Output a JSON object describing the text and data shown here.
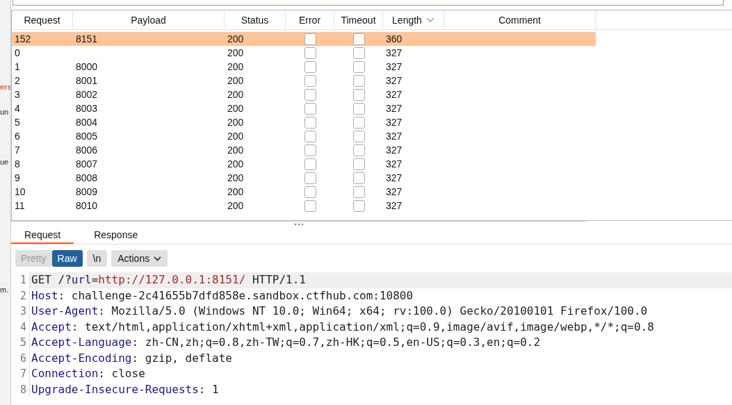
{
  "side_fragments": [
    {
      "text": "ers",
      "kind": "accent"
    },
    {
      "text": "un",
      "kind": "plain"
    },
    {
      "text": "ue",
      "kind": "plain"
    },
    {
      "text": "m.",
      "kind": "plain"
    }
  ],
  "table": {
    "columns": [
      {
        "label": "Request",
        "sorted": false
      },
      {
        "label": "Payload",
        "sorted": false
      },
      {
        "label": "Status",
        "sorted": false
      },
      {
        "label": "Error",
        "sorted": false
      },
      {
        "label": "Timeout",
        "sorted": false
      },
      {
        "label": "Length",
        "sorted": true
      },
      {
        "label": "Comment",
        "sorted": false
      }
    ],
    "rows": [
      {
        "request": "152",
        "payload": "8151",
        "status": "200",
        "error": false,
        "timeout": false,
        "length": "360",
        "selected": true
      },
      {
        "request": "0",
        "status": "200",
        "error": false,
        "timeout": false,
        "length": "327",
        "selected": false
      },
      {
        "request": "1",
        "payload": "8000",
        "status": "200",
        "error": false,
        "timeout": false,
        "length": "327",
        "selected": false
      },
      {
        "request": "2",
        "payload": "8001",
        "status": "200",
        "error": false,
        "timeout": false,
        "length": "327",
        "selected": false
      },
      {
        "request": "3",
        "payload": "8002",
        "status": "200",
        "error": false,
        "timeout": false,
        "length": "327",
        "selected": false
      },
      {
        "request": "4",
        "payload": "8003",
        "status": "200",
        "error": false,
        "timeout": false,
        "length": "327",
        "selected": false
      },
      {
        "request": "5",
        "payload": "8004",
        "status": "200",
        "error": false,
        "timeout": false,
        "length": "327",
        "selected": false
      },
      {
        "request": "6",
        "payload": "8005",
        "status": "200",
        "error": false,
        "timeout": false,
        "length": "327",
        "selected": false
      },
      {
        "request": "7",
        "payload": "8006",
        "status": "200",
        "error": false,
        "timeout": false,
        "length": "327",
        "selected": false
      },
      {
        "request": "8",
        "payload": "8007",
        "status": "200",
        "error": false,
        "timeout": false,
        "length": "327",
        "selected": false
      },
      {
        "request": "9",
        "payload": "8008",
        "status": "200",
        "error": false,
        "timeout": false,
        "length": "327",
        "selected": false
      },
      {
        "request": "10",
        "payload": "8009",
        "status": "200",
        "error": false,
        "timeout": false,
        "length": "327",
        "selected": false
      },
      {
        "request": "11",
        "payload": "8010",
        "status": "200",
        "error": false,
        "timeout": false,
        "length": "327",
        "selected": false
      }
    ]
  },
  "tabs": [
    {
      "label": "Request",
      "selected": true
    },
    {
      "label": "Response",
      "selected": false
    }
  ],
  "view_modes": [
    {
      "label": "Pretty",
      "selected": false
    },
    {
      "label": "Raw",
      "selected": true
    }
  ],
  "newline_button": "\\n",
  "actions_button": "Actions",
  "editor": {
    "lines": [
      {
        "number": "1",
        "current": true,
        "segments": [
          {
            "text": "GET /?",
            "kind": "plain"
          },
          {
            "text": "url",
            "kind": "key"
          },
          {
            "text": "=",
            "kind": "plain"
          },
          {
            "text": "http://127.0.0.1:8151/",
            "kind": "value"
          },
          {
            "text": " HTTP/1.1",
            "kind": "plain"
          }
        ]
      },
      {
        "number": "2",
        "current": false,
        "segments": [
          {
            "text": "Host",
            "kind": "key"
          },
          {
            "text": ": challenge-2c41655b7dfd858e.sandbox.ctfhub.com:10800",
            "kind": "plain"
          }
        ]
      },
      {
        "number": "3",
        "current": false,
        "segments": [
          {
            "text": "User-Agent",
            "kind": "key"
          },
          {
            "text": ": Mozilla/5.0 (Windows NT 10.0; Win64; x64; rv:100.0) Gecko/20100101 Firefox/100.0",
            "kind": "plain"
          }
        ]
      },
      {
        "number": "4",
        "current": false,
        "segments": [
          {
            "text": "Accept",
            "kind": "key"
          },
          {
            "text": ": text/html,application/xhtml+xml,application/xml;q=0.9,image/avif,image/webp,*/*;q=0.8",
            "kind": "plain"
          }
        ]
      },
      {
        "number": "5",
        "current": false,
        "segments": [
          {
            "text": "Accept-Language",
            "kind": "key"
          },
          {
            "text": ": zh-CN,zh;q=0.8,zh-TW;q=0.7,zh-HK;q=0.5,en-US;q=0.3,en;q=0.2",
            "kind": "plain"
          }
        ]
      },
      {
        "number": "6",
        "current": false,
        "segments": [
          {
            "text": "Accept-Encoding",
            "kind": "key"
          },
          {
            "text": ": gzip, deflate",
            "kind": "plain"
          }
        ]
      },
      {
        "number": "7",
        "current": false,
        "segments": [
          {
            "text": "Connection",
            "kind": "key"
          },
          {
            "text": ": close",
            "kind": "plain"
          }
        ]
      },
      {
        "number": "8",
        "current": false,
        "segments": [
          {
            "text": "Upgrade-Insecure-Requests",
            "kind": "key"
          },
          {
            "text": ": 1",
            "kind": "plain"
          }
        ]
      }
    ]
  }
}
